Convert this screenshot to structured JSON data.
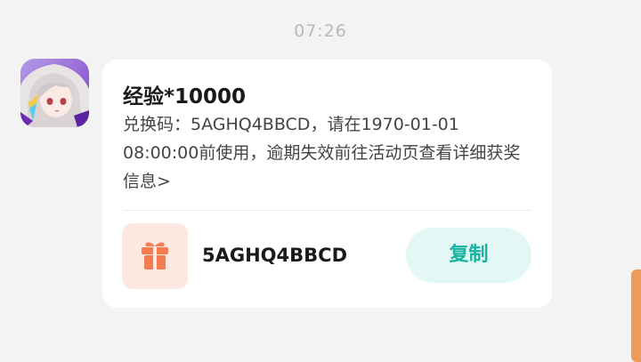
{
  "header": {
    "time": "07:26"
  },
  "message": {
    "avatar_icon": "game-character-avatar",
    "title": "经验*10000",
    "description": "兑换码：5AGHQ4BBCD，请在1970-01-01 08:00:00前使用，逾期失效前往活动页查看详细获奖信息>",
    "gift_icon": "gift-icon",
    "code": "5AGHQ4BBCD",
    "copy_label": "复制"
  },
  "colors": {
    "accent": "#17b39f",
    "copy_bg": "#e3f7f5",
    "gift": "#f47c4f",
    "gift_bg": "#fde9e1",
    "scrollbar": "#f09a58"
  }
}
